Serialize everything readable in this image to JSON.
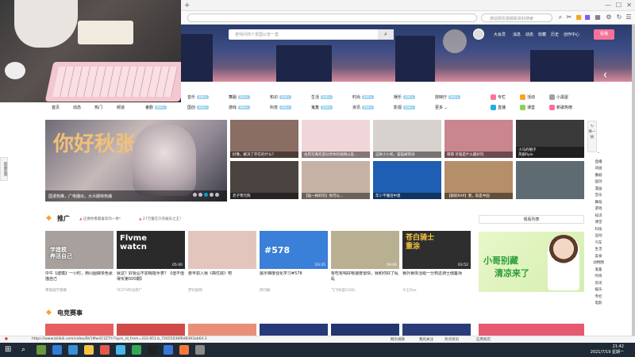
{
  "browser": {
    "search_placeholder": "搜这网页视频和百科搜索",
    "window_controls": [
      "—",
      "☐",
      "✕"
    ]
  },
  "header": {
    "search_placeholder": "老师问你个爱国公安一直",
    "nav": [
      "大会员",
      "消息",
      "动态",
      "收藏",
      "历史",
      "创作中心"
    ],
    "upload_label": "投稿"
  },
  "channels": {
    "primary": [
      "首页",
      "动态",
      "热门",
      "频道"
    ],
    "primary_extra": "番剧",
    "grid": [
      [
        "音乐",
        "舞蹈",
        "知识",
        "生活",
        "时尚",
        "娱乐",
        "放映厅"
      ],
      [
        "国创",
        "游戏",
        "科技",
        "鬼畜",
        "资讯",
        "影视",
        "更多"
      ]
    ],
    "badge": "999+",
    "right": [
      {
        "label": "专栏",
        "color": "#fb7299"
      },
      {
        "label": "活动",
        "color": "#f5a623"
      },
      {
        "label": "小黑屋",
        "color": "#a0a0a0"
      },
      {
        "label": "直播",
        "color": "#23ade5"
      },
      {
        "label": "课堂",
        "color": "#8fd14f"
      },
      {
        "label": "新歌热榜",
        "color": "#fb7299"
      }
    ]
  },
  "carousel": {
    "title": "国漫热推，广电播出，大众期待热播",
    "art_text": "你好秋张"
  },
  "thumbs_row1": [
    {
      "cap": "好像，解决了存在的什么？",
      "color": "#8a6d63"
    },
    {
      "cap": "古风写真欢迎分享你的视频以及...",
      "color": "#f1d6d9"
    },
    {
      "cap": "这款小小机，猫猫被惊讶",
      "color": "#d8d2cf"
    },
    {
      "cap": "萌萌 穷富是什么最好玩",
      "color": "#c9868e"
    },
    {
      "cap": "小马的帽子",
      "color": "#3a3a3a",
      "extra": "英剧Ryle"
    }
  ],
  "thumbs_row2": [
    {
      "cap": "老子零元购",
      "color": "#4a4340",
      "sub": "最快速做..."
    },
    {
      "cap": "【猫一样的的】你可以...",
      "color": "#c7b2a6"
    },
    {
      "cap": "年少不懂话中意",
      "color": "#1f5fb3"
    },
    {
      "cap": "【跟踪RAP】我，就是中国",
      "color": "#b58e6a"
    },
    {
      "cap": "",
      "color": "#5e6b72"
    }
  ],
  "side_tabs": [
    "换一换"
  ],
  "right_menu": [
    "直播",
    "动画",
    "番剧",
    "国创",
    "漫画",
    "音乐",
    "舞蹈",
    "游戏",
    "知识",
    "课堂",
    "科技",
    "运动",
    "汽车",
    "生活",
    "美食",
    "动物圈",
    "鬼畜",
    "时尚",
    "资讯",
    "娱乐",
    "专栏",
    "电影"
  ],
  "left_float": "新版反馈",
  "promo": {
    "title": "推广",
    "hot1": "这要你看最喜欢的一季！",
    "hot2": "27万童在只有娱乐之王！",
    "rank_label": "观看列表",
    "ad_line1": "小哥别藏",
    "ad_line2": "清凉来了",
    "cards": [
      {
        "title": "中午【建模】一小时，用闪图做单色素描自己",
        "author": "零基础学建模",
        "duration": "",
        "color": "#a8a09c",
        "overlay": "学建模\n养活自己"
      },
      {
        "title": "就这？好受忍不如嗯能手表？【值不值得买第500期】",
        "author": "TESTV吹台原厂",
        "duration": "05:40",
        "color": "#2a2a2a",
        "overlay": "Flvme\nwatcn"
      },
      {
        "title": "要丰如入我《斋优院》吧",
        "author": "梦幻剧场",
        "duration": "",
        "color": "#e2c6bd",
        "overlay": ""
      },
      {
        "title": "展示梯度强化学习#578",
        "author": "周刊解",
        "duration": "03:35",
        "color": "#3a7fd8",
        "overlay": "#578"
      },
      {
        "title": "有吃有喝好嗯速度很快，我和你好了乱乱",
        "author": "飞飞你是COOL",
        "duration": "09:06",
        "color": "#b8b090",
        "overlay": ""
      },
      {
        "title": "赛外赛体活题一分到这骑士储备场",
        "author": "大士Dos",
        "duration": "03:52",
        "color": "#2e2e2e",
        "overlay": "苍白骑士\n重涂"
      }
    ]
  },
  "esports": {
    "title": "电竞赛事"
  },
  "status": {
    "url": "https://www.bilibili.com/video/BV1Mw411Z7Yr?spm_id_from=333.851.b_72655036f6d6d93ab64.3",
    "items": [
      "网页视频",
      "我的关注",
      "热点资讯",
      "应用商店"
    ]
  },
  "clock": {
    "time": "21:42",
    "date": "2021/7/19 星期一"
  }
}
